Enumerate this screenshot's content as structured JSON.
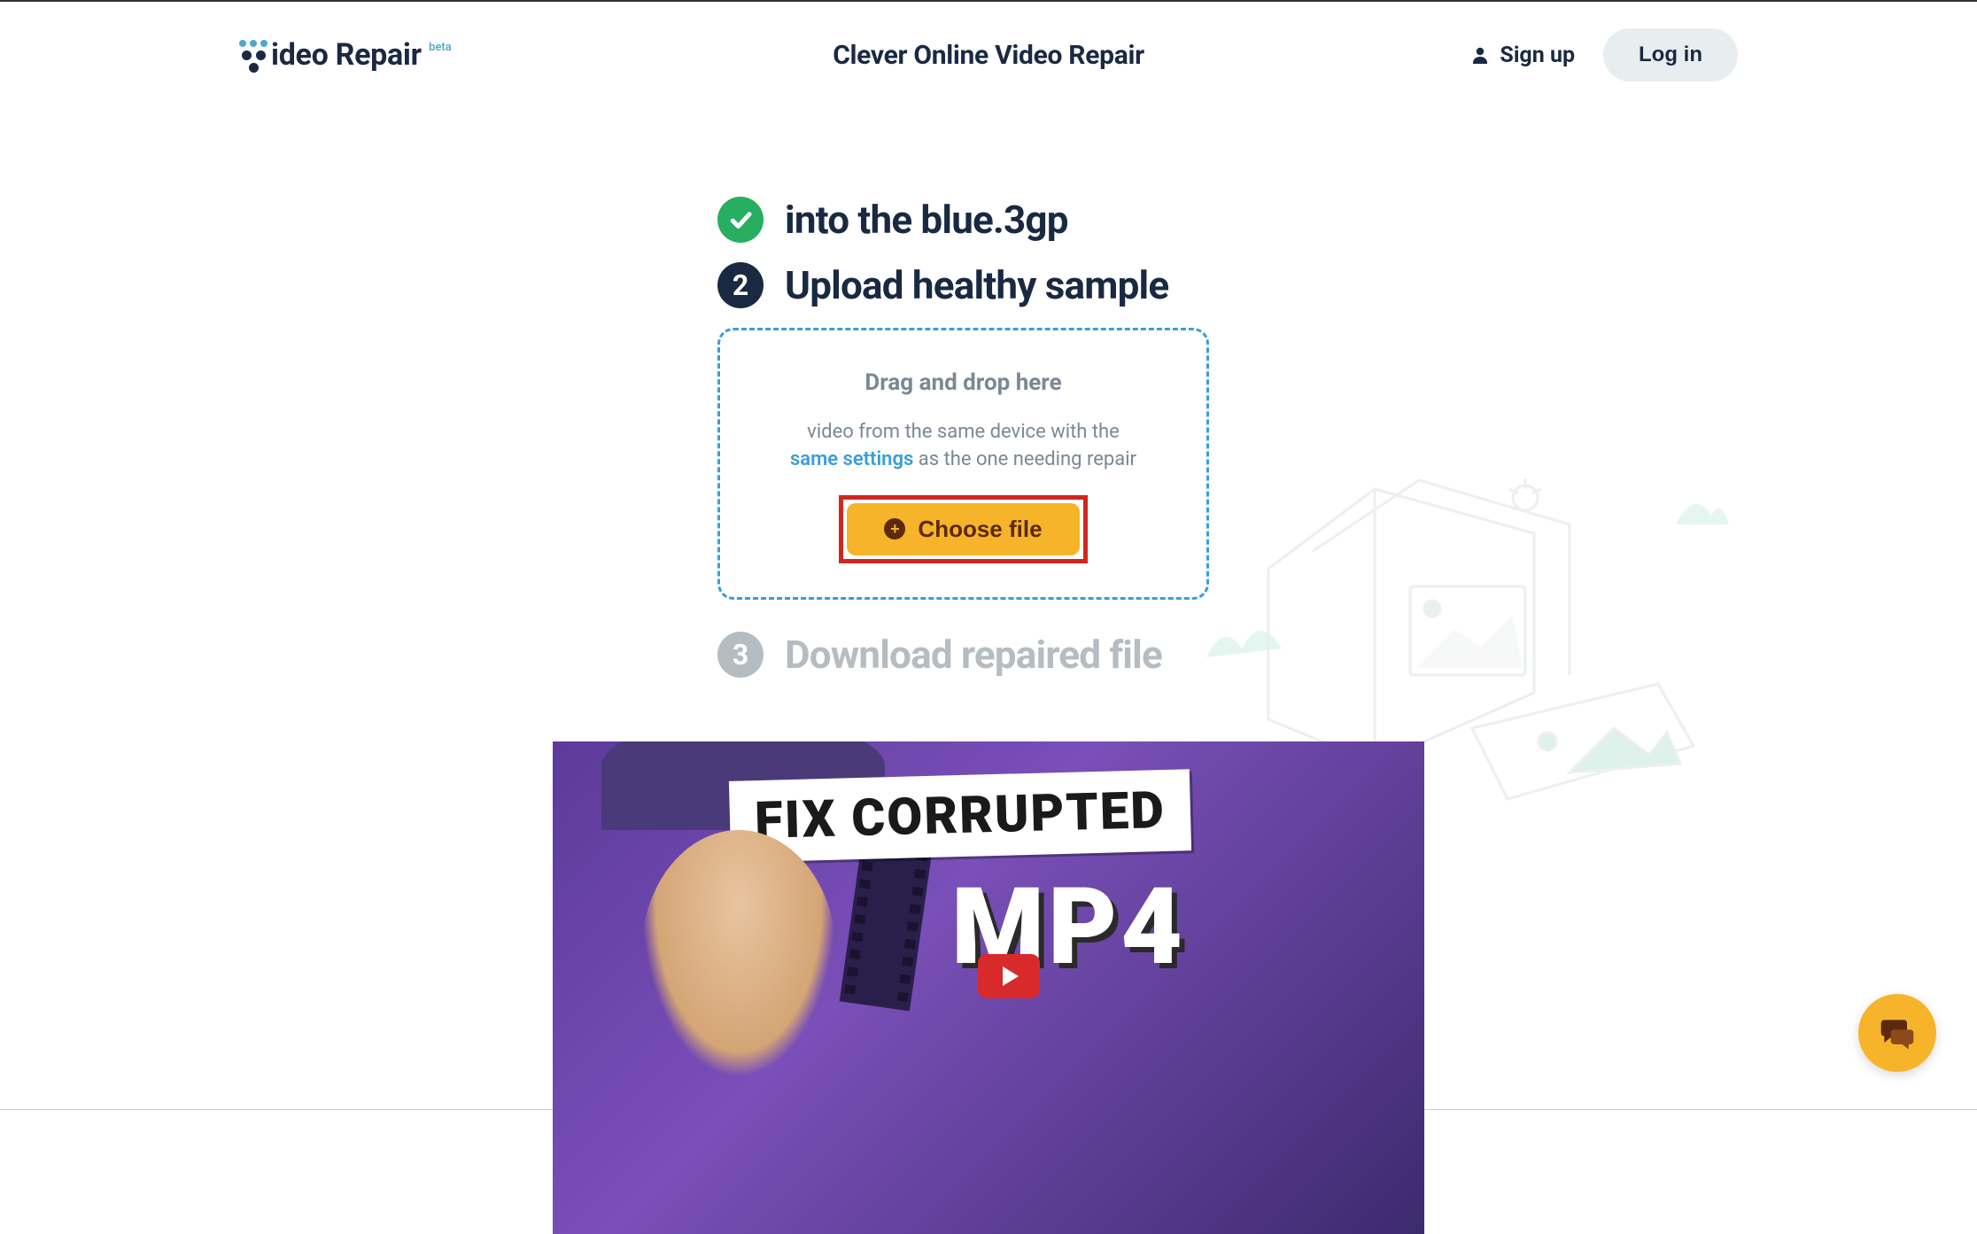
{
  "header": {
    "logo_text": "ideo Repair",
    "logo_badge": "beta",
    "title": "Clever Online Video Repair",
    "signup_label": "Sign up",
    "login_label": "Log in"
  },
  "steps": {
    "step1": {
      "filename": "into the blue.3gp"
    },
    "step2": {
      "number": "2",
      "title": "Upload healthy sample"
    },
    "step3": {
      "number": "3",
      "title": "Download repaired file"
    }
  },
  "dropzone": {
    "title": "Drag and drop here",
    "sub_line1": "video from the same device with the",
    "sub_link": "same settings",
    "sub_line2_rest": " as the one needing repair",
    "choose_file_label": "Choose file"
  },
  "video_thumb": {
    "line1": "FIX CORRUPTED",
    "line2": "MP4"
  },
  "colors": {
    "primary_dark": "#1a2942",
    "accent_blue": "#3b9dd9",
    "accent_yellow": "#f5b429",
    "success_green": "#27ae60",
    "muted_gray": "#b5bcc2",
    "highlight_red": "#d1261f"
  }
}
